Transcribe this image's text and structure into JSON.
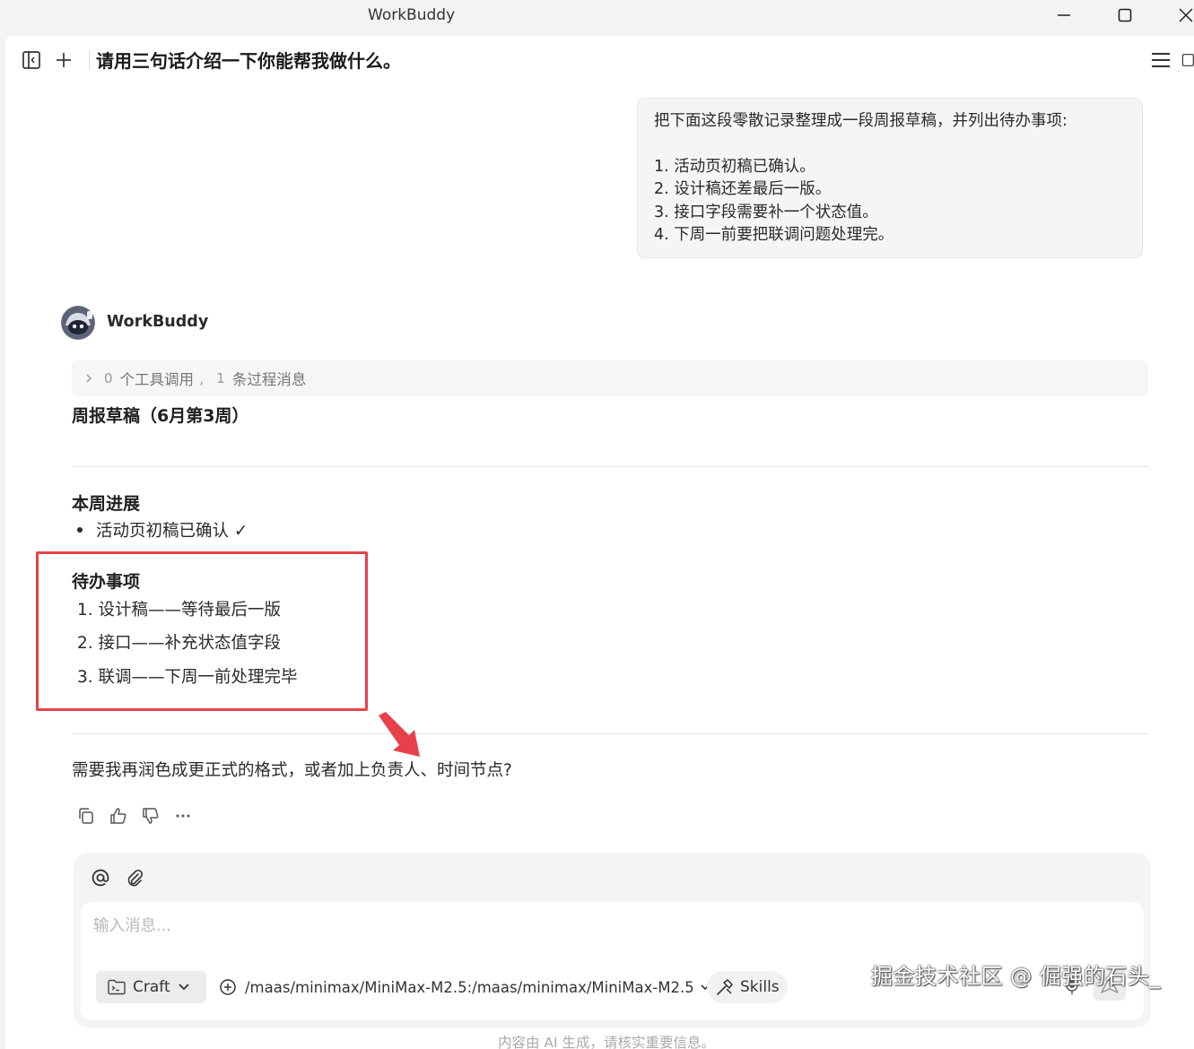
{
  "window": {
    "title": "WorkBuddy"
  },
  "header": {
    "conversation_title": "请用三句话介绍一下你能帮我做什么。"
  },
  "user_message": {
    "intro": "把下面这段零散记录整理成一段周报草稿，并列出待办事项:",
    "items": [
      "1. 活动页初稿已确认。",
      "2. 设计稿还差最后一版。",
      "3. 接口字段需要补一个状态值。",
      "4. 下周一前要把联调问题处理完。"
    ]
  },
  "assistant": {
    "name": "WorkBuddy",
    "tool_summary": {
      "tool_count": "0",
      "tool_label": "个工具调用",
      "separator": ",",
      "process_count": "1",
      "process_label": "条过程消息"
    },
    "report_title": "周报草稿（6月第3周）",
    "progress_heading": "本周进展",
    "progress_items": [
      "活动页初稿已确认 ✓"
    ],
    "todo_heading": "待办事项",
    "todo_items": [
      "1. 设计稿——等待最后一版",
      "2. 接口——补充状态值字段",
      "3. 联调——下周一前处理完毕"
    ],
    "closing": "需要我再润色成更正式的格式，或者加上负责人、时间节点?"
  },
  "composer": {
    "placeholder": "输入消息...",
    "mode_label": "Craft",
    "model_label": "/maas/minimax/MiniMax-M2.5:/maas/minimax/MiniMax-M2.5",
    "skills_label": "Skills"
  },
  "disclaimer": "内容由 AI 生成，请核实重要信息。",
  "watermark": "掘金技术社区 @ 倔强的石头_",
  "colors": {
    "highlight": "#e8404a",
    "background": "#ffffff",
    "chrome": "#f3f3f3"
  }
}
